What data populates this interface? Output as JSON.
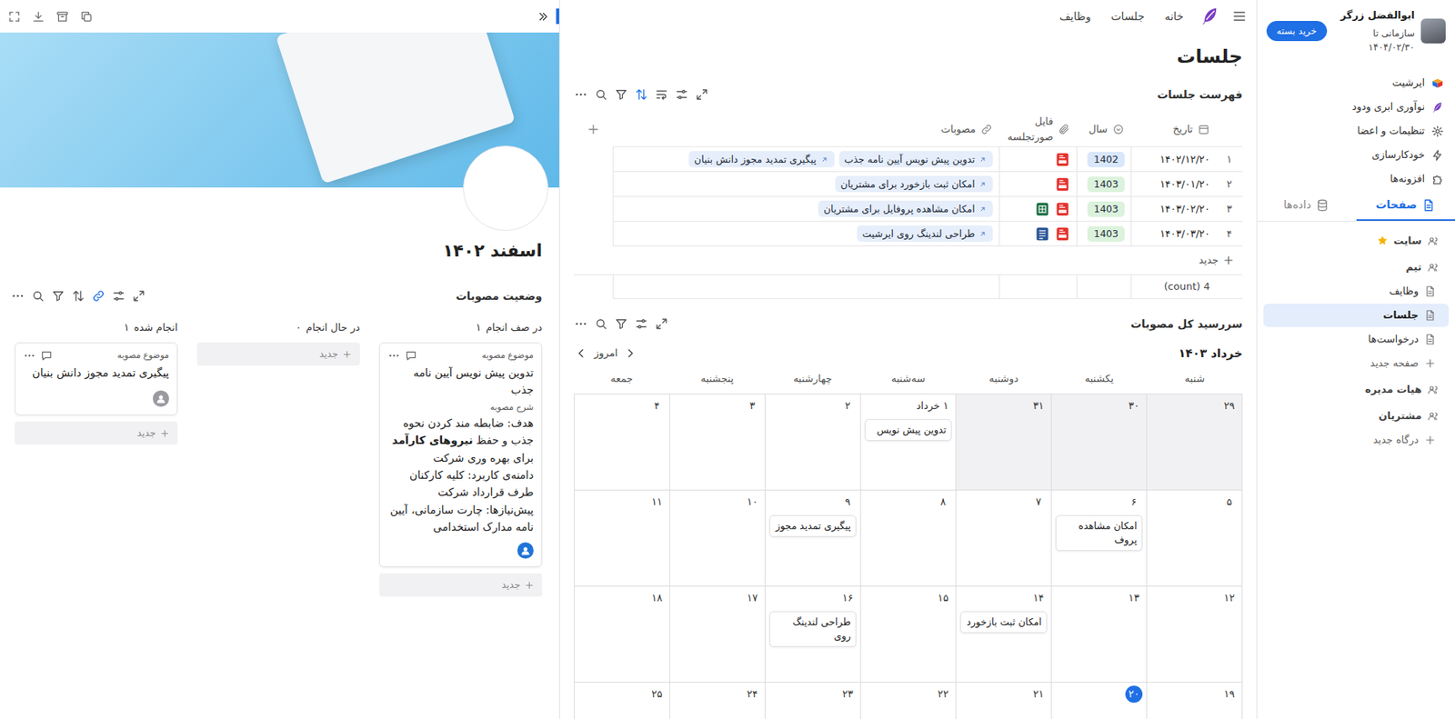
{
  "sidebar": {
    "user": {
      "name": "ابوالفضل زرگر",
      "plan": "سازمانی تا ۱۴۰۴/۰۲/۳۰",
      "button": "خرید بسته"
    },
    "menu": [
      {
        "label": "ایرشیت"
      },
      {
        "label": "نوآوری ابری ودود"
      },
      {
        "label": "تنظیمات و اعضا"
      },
      {
        "label": "خودکارسازی"
      },
      {
        "label": "افزونه‌ها"
      }
    ],
    "tabs": [
      {
        "label": "صفحات",
        "selected": true
      },
      {
        "label": "داده‌ها",
        "selected": false
      }
    ],
    "tree": [
      {
        "label": "سایت",
        "kind": "group",
        "starred": true,
        "selected": false
      },
      {
        "label": "تیم",
        "kind": "group",
        "starred": false,
        "selected": false
      },
      {
        "label": "وظایف",
        "kind": "page",
        "starred": false,
        "selected": false
      },
      {
        "label": "جلسات",
        "kind": "page",
        "starred": false,
        "selected": true
      },
      {
        "label": "درخواست‌ها",
        "kind": "page",
        "starred": false,
        "selected": false
      },
      {
        "label": "صفحه جدید",
        "kind": "add",
        "starred": false,
        "selected": false
      },
      {
        "label": "هیات مدیره",
        "kind": "group",
        "starred": false,
        "selected": false
      },
      {
        "label": "مشتریان",
        "kind": "group",
        "starred": false,
        "selected": false
      },
      {
        "label": "درگاه جدید",
        "kind": "add",
        "starred": false,
        "selected": false
      }
    ]
  },
  "topbar": {
    "links": [
      {
        "label": "خانه"
      },
      {
        "label": "جلسات"
      },
      {
        "label": "وظایف"
      }
    ]
  },
  "page_title": "جلسات",
  "table": {
    "title": "فهرست جلسات",
    "sort_active": true,
    "columns": [
      {
        "label": "تاریخ"
      },
      {
        "label": "سال"
      },
      {
        "label": "فایل صورتجلسه"
      },
      {
        "label": "مصوبات"
      }
    ],
    "rows": [
      {
        "num": "۱",
        "date": "۱۴۰۲/۱۲/۲۰",
        "year": {
          "label": "1402",
          "color": "#d9e7fb"
        },
        "files": [
          {
            "kind": "pdf"
          }
        ],
        "items": [
          {
            "label": "تدوین پیش نویس آیین نامه جذب"
          },
          {
            "label": "پیگیری تمدید مجوز دانش بنیان"
          }
        ]
      },
      {
        "num": "۲",
        "date": "۱۴۰۳/۰۱/۲۰",
        "year": {
          "label": "1403",
          "color": "#dcf2dc"
        },
        "files": [
          {
            "kind": "pdf"
          }
        ],
        "items": [
          {
            "label": "امکان ثبت بازخورد برای مشتریان"
          }
        ]
      },
      {
        "num": "۳",
        "date": "۱۴۰۳/۰۲/۲۰",
        "year": {
          "label": "1403",
          "color": "#dcf2dc"
        },
        "files": [
          {
            "kind": "pdf"
          },
          {
            "kind": "excel"
          }
        ],
        "items": [
          {
            "label": "امکان مشاهده پروفایل برای مشتریان"
          }
        ]
      },
      {
        "num": "۴",
        "date": "۱۴۰۳/۰۳/۲۰",
        "year": {
          "label": "1403",
          "color": "#dcf2dc"
        },
        "files": [
          {
            "kind": "pdf"
          },
          {
            "kind": "word"
          }
        ],
        "items": [
          {
            "label": "طراحی لندینگ روی ایرشیت"
          }
        ]
      }
    ],
    "new_row": "جدید",
    "footer": "4 (count)"
  },
  "calendar": {
    "title": "سررسید کل مصوبات",
    "month": "خرداد ۱۴۰۳",
    "today_button": "امروز",
    "weekdays": [
      "شنبه",
      "یکشنبه",
      "دوشنبه",
      "سه‌شنبه",
      "چهارشنبه",
      "پنجشنبه",
      "جمعه"
    ],
    "weeks": [
      [
        {
          "day": "۲۹",
          "outside": true,
          "today": false,
          "events": []
        },
        {
          "day": "۳۰",
          "outside": true,
          "today": false,
          "events": []
        },
        {
          "day": "۳۱",
          "outside": true,
          "today": false,
          "events": []
        },
        {
          "day": "۱ خرداد",
          "outside": false,
          "today": false,
          "events": [
            {
              "label": "تدوین پیش نویس"
            }
          ]
        },
        {
          "day": "۲",
          "outside": false,
          "today": false,
          "events": []
        },
        {
          "day": "۳",
          "outside": false,
          "today": false,
          "events": []
        },
        {
          "day": "۴",
          "outside": false,
          "today": false,
          "events": []
        }
      ],
      [
        {
          "day": "۵",
          "outside": false,
          "today": false,
          "events": []
        },
        {
          "day": "۶",
          "outside": false,
          "today": false,
          "events": [
            {
              "label": "امکان مشاهده پروف"
            }
          ]
        },
        {
          "day": "۷",
          "outside": false,
          "today": false,
          "events": []
        },
        {
          "day": "۸",
          "outside": false,
          "today": false,
          "events": []
        },
        {
          "day": "۹",
          "outside": false,
          "today": false,
          "events": [
            {
              "label": "پیگیری تمدید مجوز"
            }
          ]
        },
        {
          "day": "۱۰",
          "outside": false,
          "today": false,
          "events": []
        },
        {
          "day": "۱۱",
          "outside": false,
          "today": false,
          "events": []
        }
      ],
      [
        {
          "day": "۱۲",
          "outside": false,
          "today": false,
          "events": []
        },
        {
          "day": "۱۳",
          "outside": false,
          "today": false,
          "events": []
        },
        {
          "day": "۱۴",
          "outside": false,
          "today": false,
          "events": [
            {
              "label": "امکان ثبت بازخورد"
            }
          ]
        },
        {
          "day": "۱۵",
          "outside": false,
          "today": false,
          "events": []
        },
        {
          "day": "۱۶",
          "outside": false,
          "today": false,
          "events": [
            {
              "label": "طراحی لندینگ روی"
            }
          ]
        },
        {
          "day": "۱۷",
          "outside": false,
          "today": false,
          "events": []
        },
        {
          "day": "۱۸",
          "outside": false,
          "today": false,
          "events": []
        }
      ],
      [
        {
          "day": "۱۹",
          "outside": false,
          "today": false,
          "events": []
        },
        {
          "day": "۲۰",
          "outside": false,
          "today": true,
          "events": []
        },
        {
          "day": "۲۱",
          "outside": false,
          "today": false,
          "events": []
        },
        {
          "day": "۲۲",
          "outside": false,
          "today": false,
          "events": []
        },
        {
          "day": "۲۳",
          "outside": false,
          "today": false,
          "events": []
        },
        {
          "day": "۲۴",
          "outside": false,
          "today": false,
          "events": []
        },
        {
          "day": "۲۵",
          "outside": false,
          "today": false,
          "events": []
        }
      ]
    ]
  },
  "doc": {
    "title": "اسفند ۱۴۰۲",
    "board": {
      "title": "وضعیت مصوبات",
      "link_active": true,
      "columns": [
        {
          "label": "در صف انجام",
          "count": "۱",
          "new": "جدید",
          "cards": [
            {
              "subject_label": "موضوع مصوبه",
              "title": "تدوین پیش نویس آیین نامه جذب",
              "desc_label": "شرح مصوبه",
              "desc": [
                [
                  {
                    "text": "هدف: ضابطه مند کردن نحوه جذب و حفظ ",
                    "bold": false
                  },
                  {
                    "text": "نیروهای کارآمد",
                    "bold": true
                  },
                  {
                    "text": " برای بهره وری شرکت",
                    "bold": false
                  }
                ],
                [
                  {
                    "text": "دامنه‌ی کاربرد: کلیه کارکنان طرف قرارداد شرکت",
                    "bold": false
                  }
                ],
                [
                  {
                    "text": "پیش‌نیازها: چارت سازمانی، آیین نامه مدارک استخدامی",
                    "bold": false
                  }
                ]
              ],
              "avatar_color": "#1f73d8"
            }
          ]
        },
        {
          "label": "در حال انجام",
          "count": "۰",
          "new": "جدید",
          "cards": []
        },
        {
          "label": "انجام شده",
          "count": "۱",
          "new": "جدید",
          "cards": [
            {
              "subject_label": "موضوع مصوبه",
              "title": "پیگیری تمدید مجوز دانش بنیان",
              "desc_label": "",
              "desc": [],
              "avatar_color": "#9a9aa0"
            }
          ]
        }
      ]
    }
  }
}
